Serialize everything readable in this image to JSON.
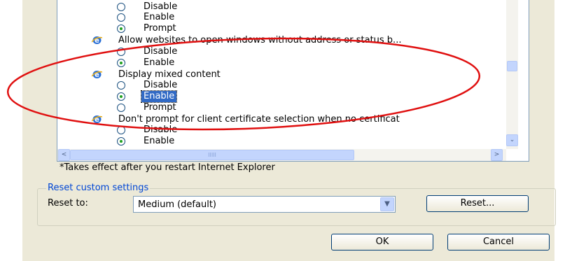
{
  "settings_list": {
    "rows": [
      {
        "type": "option",
        "label": "Disable",
        "checked": false
      },
      {
        "type": "option",
        "label": "Enable",
        "checked": false
      },
      {
        "type": "option",
        "label": "Prompt",
        "checked": true
      },
      {
        "type": "category",
        "label": "Allow websites to open windows without address or status b..."
      },
      {
        "type": "option",
        "label": "Disable",
        "checked": false
      },
      {
        "type": "option",
        "label": "Enable",
        "checked": true
      },
      {
        "type": "category",
        "label": "Display mixed content"
      },
      {
        "type": "option",
        "label": "Disable",
        "checked": false
      },
      {
        "type": "option",
        "label": "Enable",
        "checked": true,
        "selected": true
      },
      {
        "type": "option",
        "label": "Prompt",
        "checked": false
      },
      {
        "type": "category",
        "label": "Don't prompt for client certificate selection when no certificat"
      },
      {
        "type": "option",
        "label": "Disable",
        "checked": false
      },
      {
        "type": "option",
        "label": "Enable",
        "checked": true
      }
    ]
  },
  "note": "*Takes effect after you restart Internet Explorer",
  "reset_group": {
    "title": "Reset custom settings",
    "reset_to_label": "Reset to:",
    "selected_level": "Medium (default)",
    "reset_button": "Reset..."
  },
  "buttons": {
    "ok": "OK",
    "cancel": "Cancel"
  },
  "scrollbar": {
    "h_thumb_grip": "IIIII",
    "left_arrow": "<",
    "right_arrow": ">",
    "down_arrow": "⌄"
  },
  "icons": {
    "category": "ie-icon",
    "annotation": "red-ellipse"
  },
  "colors": {
    "annotation": "#e01010",
    "selection": "#316ac5",
    "dialog_bg": "#ece9d8"
  }
}
